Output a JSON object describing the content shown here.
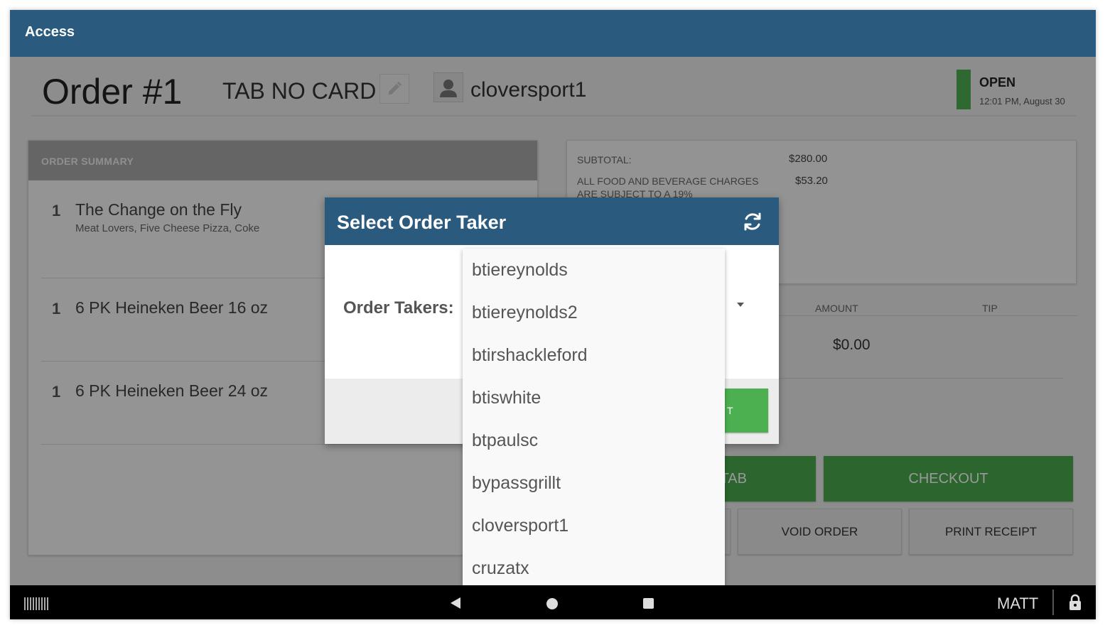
{
  "appbar": {
    "title": "Access"
  },
  "header": {
    "order_title": "Order #1",
    "tab_name": "TAB NO CARD",
    "user": "cloversport1",
    "status": "OPEN",
    "status_time": "12:01 PM, August 30"
  },
  "summary": {
    "header": "ORDER SUMMARY",
    "items": [
      {
        "qty": "1",
        "name": "The Change on the Fly",
        "mods": "Meat Lovers, Five Cheese Pizza, Coke"
      },
      {
        "qty": "1",
        "name": "6 PK Heineken Beer 16 oz",
        "mods": ""
      },
      {
        "qty": "1",
        "name": "6 PK Heineken Beer 24 oz",
        "mods": ""
      }
    ]
  },
  "totals": {
    "subtotal_label": "SUBTOTAL:",
    "subtotal_value": "$280.00",
    "service_label": "ALL FOOD AND BEVERAGE CHARGES ARE SUBJECT TO A 19%",
    "service_value": "$53.20"
  },
  "payments": {
    "amount_header": "AMOUNT",
    "tip_header": "TIP",
    "amount_value": "$0.00"
  },
  "actions": {
    "tab_partial": "TAB",
    "checkout": "CHECKOUT",
    "void_order": "VOID ORDER",
    "print_receipt": "PRINT RECEIPT"
  },
  "dialog": {
    "title": "Select Order Taker",
    "field_label": "Order Takers:",
    "ok_partial": "T",
    "options": [
      "btiereynolds",
      "btiereynolds2",
      "btirshackleford",
      "btiswhite",
      "btpaulsc",
      "bypassgrillt",
      "cloversport1",
      "cruzatx"
    ]
  },
  "navbar": {
    "user": "MATT"
  },
  "colors": {
    "brand": "#2a5b7e",
    "accent_green": "#4caf50",
    "status_open": "#4caf50"
  },
  "icons": [
    "pencil-icon",
    "user-avatar-icon",
    "refresh-icon",
    "barcode-icon",
    "back-icon",
    "home-icon",
    "recents-icon",
    "lock-icon"
  ]
}
